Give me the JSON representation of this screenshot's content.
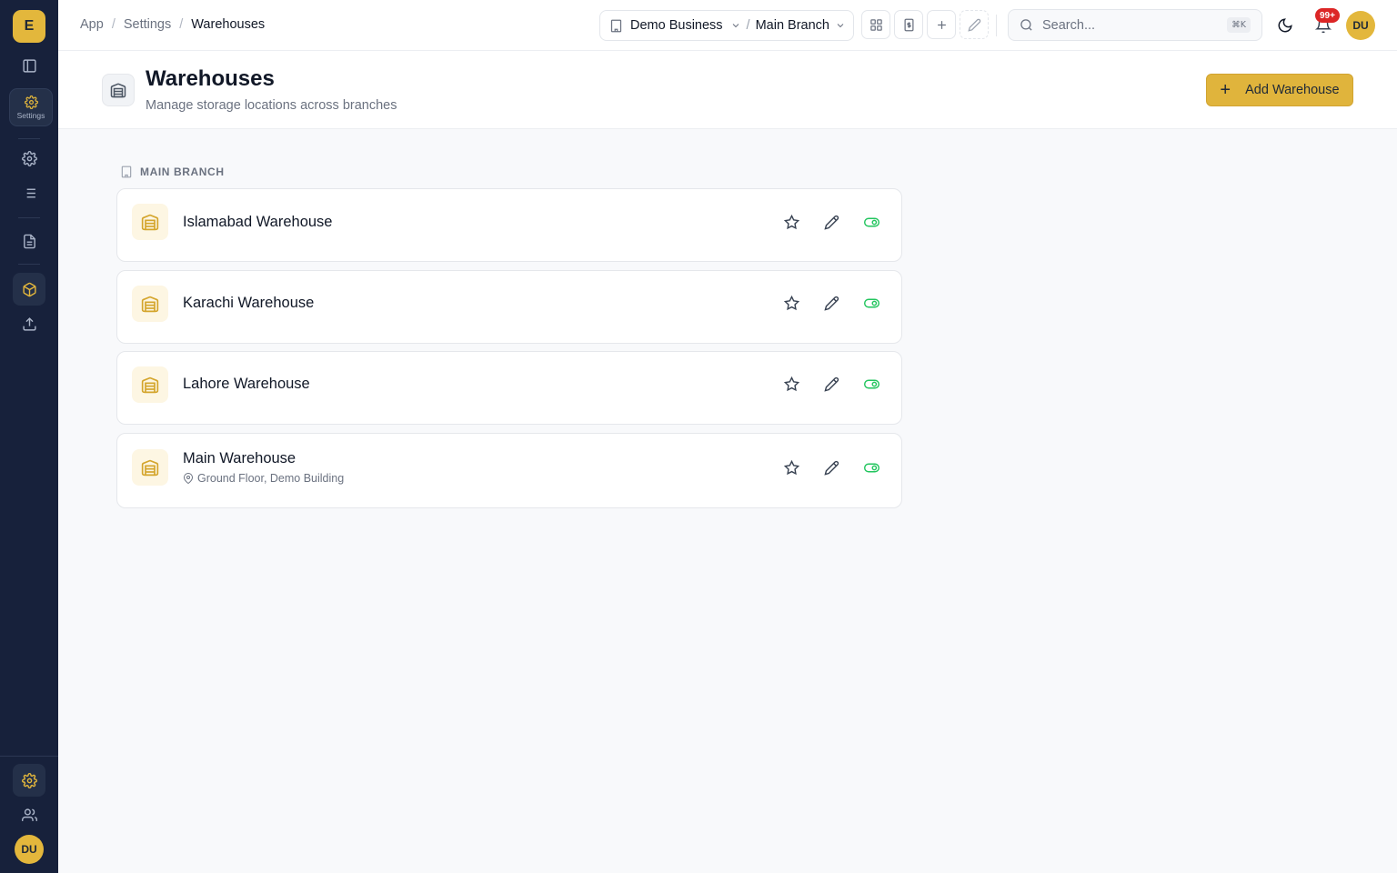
{
  "sidebar": {
    "logo_letter": "E",
    "settings_label": "Settings",
    "avatar_initials": "DU"
  },
  "topbar": {
    "breadcrumbs": [
      "App",
      "Settings",
      "Warehouses"
    ],
    "crumb_separator": "/",
    "business": "Demo Business",
    "branch": "Main Branch",
    "search_placeholder": "Search...",
    "search_shortcut": "⌘K",
    "notifications_badge": "99+",
    "avatar_initials": "DU"
  },
  "page": {
    "title": "Warehouses",
    "subtitle": "Manage storage locations across branches",
    "add_button_label": "Add Warehouse"
  },
  "group": {
    "label": "MAIN BRANCH",
    "warehouses": [
      {
        "name": "Islamabad Warehouse",
        "address": ""
      },
      {
        "name": "Karachi Warehouse",
        "address": ""
      },
      {
        "name": "Lahore Warehouse",
        "address": ""
      },
      {
        "name": "Main Warehouse",
        "address": "Ground Floor, Demo Building"
      }
    ]
  },
  "colors": {
    "brand": "#e0b43c",
    "sidebar": "#17213b",
    "active_toggle": "#22c55e",
    "badge": "#dc2626"
  }
}
